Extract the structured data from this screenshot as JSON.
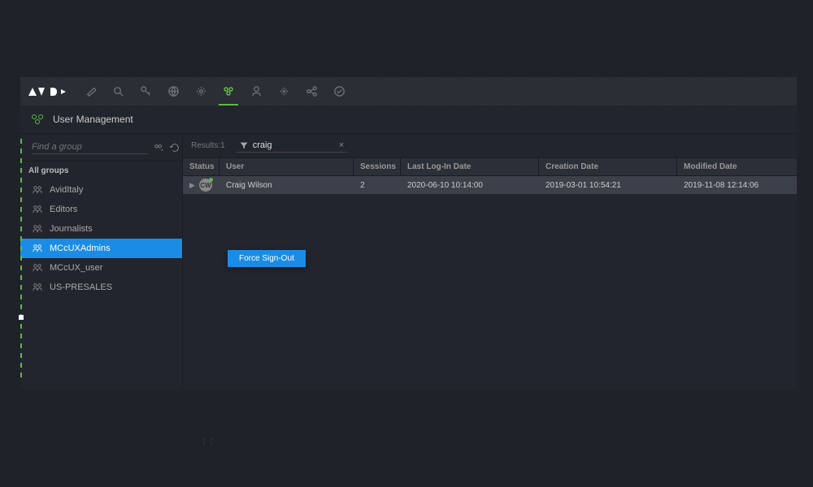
{
  "header": {
    "title": "User Management"
  },
  "sidebar": {
    "search_placeholder": "Find a group",
    "groups_label": "All groups",
    "items": [
      {
        "label": "AvidItaly"
      },
      {
        "label": "Editors"
      },
      {
        "label": "Journalists"
      },
      {
        "label": "MCcUXAdmins"
      },
      {
        "label": "MCcUX_user"
      },
      {
        "label": "US-PRESALES"
      }
    ],
    "selected_index": 3
  },
  "filter": {
    "results_label": "Results:",
    "results_count": "1",
    "value": "craig"
  },
  "table": {
    "headers": {
      "status": "Status",
      "user": "User",
      "sessions": "Sessions",
      "last_login": "Last Log-In Date",
      "creation": "Creation Date",
      "modified": "Modified Date"
    },
    "rows": [
      {
        "avatar": "CW",
        "user": "Craig Wilson",
        "sessions": "2",
        "last_login": "2020-06-10 10:14:00",
        "creation": "2019-03-01 10:54:21",
        "modified": "2019-11-08 12:14:06"
      }
    ]
  },
  "context_menu": {
    "label": "Force Sign-Out"
  }
}
